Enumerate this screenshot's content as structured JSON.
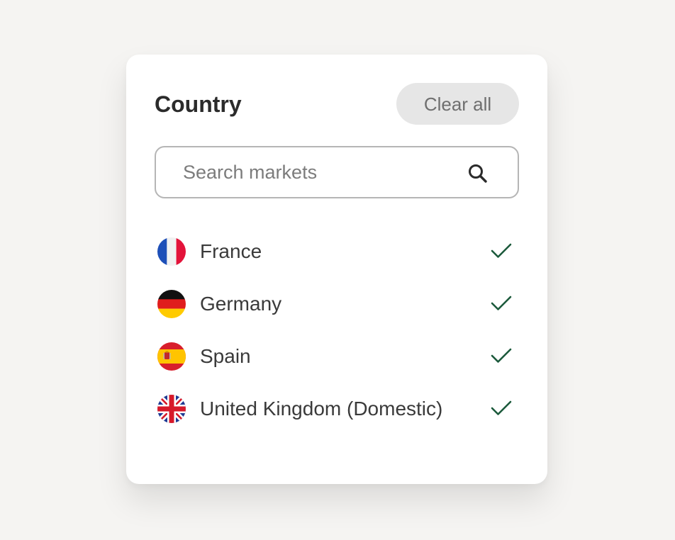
{
  "filter": {
    "title": "Country",
    "clear_label": "Clear all",
    "search_placeholder": "Search markets"
  },
  "countries": [
    {
      "label": "France",
      "selected": true
    },
    {
      "label": "Germany",
      "selected": true
    },
    {
      "label": "Spain",
      "selected": true
    },
    {
      "label": "United Kingdom (Domestic)",
      "selected": true
    }
  ],
  "colors": {
    "check": "#1c5a3c",
    "clear_bg": "#e6e6e6",
    "border": "#b5b5b5",
    "page_bg": "#f5f4f2"
  }
}
